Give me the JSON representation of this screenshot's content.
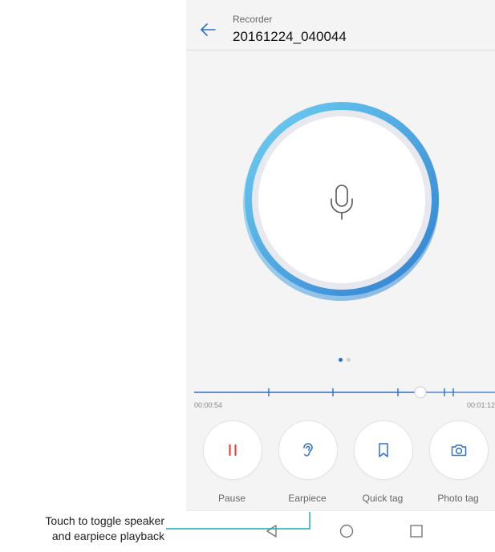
{
  "header": {
    "back_icon": "arrow-left-icon",
    "subtitle": "Recorder",
    "title": "20161224_040044"
  },
  "dial": {
    "icon": "microphone-icon",
    "colors": {
      "ring_light": "#5ec3ee",
      "ring_dark": "#2f7fd0",
      "inner": "#ffffff",
      "track": "#e7e9ee"
    }
  },
  "pager": {
    "pages": 2,
    "active": 0
  },
  "timeline": {
    "start_time": "00:00:54",
    "end_time": "00:01:12",
    "played_fraction": 0.74,
    "accent_color": "#2e6fc8"
  },
  "controls": [
    {
      "label": "Pause",
      "icon": "pause-icon",
      "color": "#e53935"
    },
    {
      "label": "Earpiece",
      "icon": "ear-icon",
      "color": "#2e6fc8"
    },
    {
      "label": "Quick tag",
      "icon": "bookmark-icon",
      "color": "#2e6fc8"
    },
    {
      "label": "Photo tag",
      "icon": "camera-icon",
      "color": "#2e6fc8"
    }
  ],
  "navbar": {
    "icons": [
      "back-triangle-icon",
      "home-circle-icon",
      "recents-square-icon"
    ]
  },
  "callout": {
    "line1": "Touch to toggle speaker",
    "line2": "and earpiece playback",
    "color": "#1aa7b8"
  }
}
